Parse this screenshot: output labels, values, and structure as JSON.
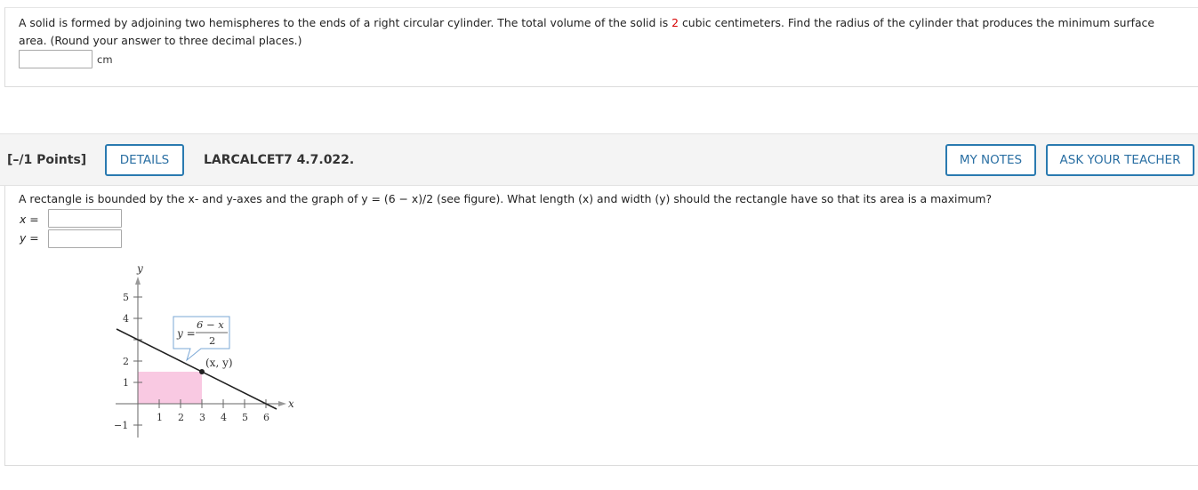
{
  "question1": {
    "text_before": "A solid is formed by adjoining two hemispheres to the ends of a right circular cylinder. The total volume of the solid is ",
    "highlight_value": "2",
    "text_after": " cubic centimeters. Find the radius of the cylinder that produces the minimum surface area. (Round your answer to three decimal places.)",
    "answer_value": "",
    "unit": "cm"
  },
  "header": {
    "points": "[–/1 Points]",
    "details_label": "DETAILS",
    "question_id": "LARCALCET7 4.7.022.",
    "my_notes_label": "MY NOTES",
    "ask_teacher_label": "ASK YOUR TEACHER"
  },
  "question2": {
    "text": "A rectangle is bounded by the x- and y-axes and the graph of y = (6 − x)/2 (see figure). What length (x) and width (y) should the rectangle have so that its area is a maximum?",
    "x_label": "x =",
    "y_label": "y =",
    "x_value": "",
    "y_value": ""
  },
  "figure": {
    "y_axis_label": "y",
    "x_axis_label": "x",
    "y_ticks": [
      "5",
      "4",
      "2",
      "1",
      "−1"
    ],
    "x_ticks": [
      "1",
      "2",
      "3",
      "4",
      "5",
      "6"
    ],
    "equation_lhs": "y =",
    "equation_num": "6 − x",
    "equation_den": "2",
    "point_label": "(x, y)",
    "colors": {
      "rectangle": "#f9c9e2",
      "line": "#222222",
      "callout_border": "#7aa7d6"
    }
  }
}
